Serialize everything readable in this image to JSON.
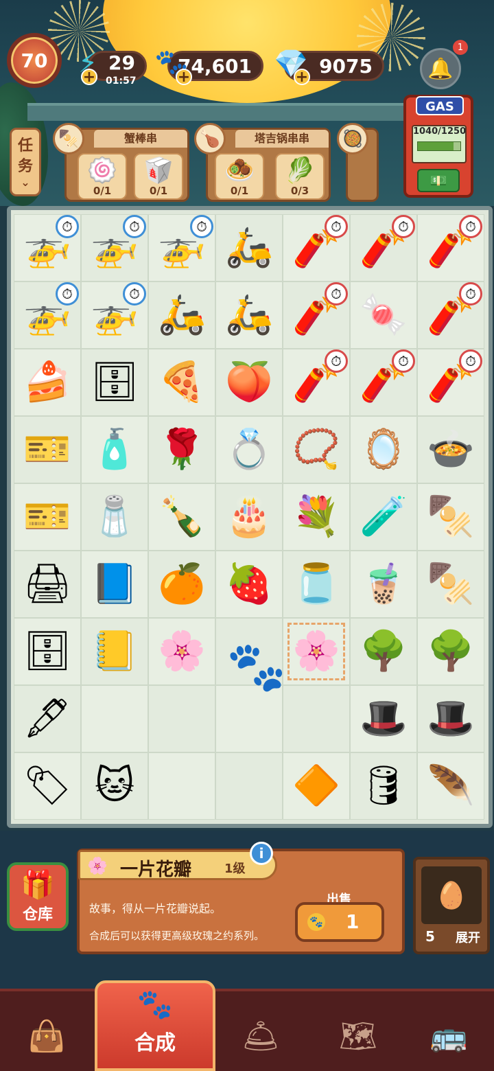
{
  "hud": {
    "level": "70",
    "energy": "29",
    "energy_timer": "01:57",
    "coins": "74,601",
    "gems": "9075",
    "notification_count": "1",
    "plus": "+"
  },
  "tasks": {
    "tab_label_1": "任",
    "tab_label_2": "务",
    "orders": [
      {
        "title": "蟹棒串",
        "slots": [
          {
            "count": "0/1"
          },
          {
            "count": "0/1"
          }
        ]
      },
      {
        "title": "塔吉锅串串",
        "slots": [
          {
            "count": "0/1"
          },
          {
            "count": "0/3"
          }
        ]
      }
    ]
  },
  "gas_station": {
    "label": "GAS",
    "readout": "1040/1250",
    "level": 0.832
  },
  "board": {
    "cells": [
      "🚁",
      "🚁",
      "🚁",
      "🛵",
      "🧨",
      "🧨",
      "🧨",
      "🚁",
      "🚁",
      "🛵",
      "🛵",
      "🧨",
      "🍬",
      "🧨",
      "🍰",
      "🗄",
      "🍕",
      "🍑",
      "🧨",
      "🧨",
      "🧨",
      "🎫",
      "🧴",
      "🌹",
      "💍",
      "📿",
      "🪞",
      "🍲",
      "🎫",
      "🧂",
      "🍾",
      "🎂",
      "💐",
      "🧪",
      "🍢",
      "🖨",
      "📘",
      "🍊",
      "🍓",
      "🫙",
      "🧋",
      "🍢",
      "🗄",
      "📒",
      "🌸",
      "",
      "🌸",
      "🌳",
      "🌳",
      "🖋",
      "",
      "",
      "",
      "",
      "🎩",
      "🎩",
      "🏷",
      "🐱",
      "",
      "",
      "🔶",
      "🛢",
      "🪶"
    ],
    "selected_index": 46
  },
  "item_info": {
    "name": "一片花瓣",
    "level": "1级",
    "info_button": "i",
    "description_1": "故事，得从一片花瓣说起。",
    "description_2": "合成后可以获得更高级玫瑰之约系列。",
    "sell_label": "出售",
    "sell_price": "1"
  },
  "warehouse": {
    "label": "仓库"
  },
  "expand": {
    "count": "5",
    "label": "展开"
  },
  "nav": {
    "active_label": "合成"
  }
}
